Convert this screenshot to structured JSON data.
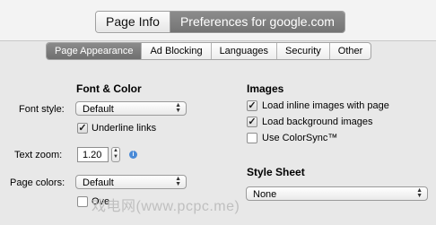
{
  "top_tabs": [
    "Page Info",
    "Preferences for google.com"
  ],
  "tabs": [
    "Page Appearance",
    "Ad Blocking",
    "Languages",
    "Security",
    "Other"
  ],
  "font_color": {
    "heading": "Font & Color",
    "font_style_label": "Font style:",
    "font_style_value": "Default",
    "underline_links": "Underline links",
    "text_zoom_label": "Text zoom:",
    "text_zoom_value": "1.20",
    "page_colors_label": "Page colors:",
    "page_colors_value": "Default",
    "override_label": "Ove"
  },
  "images": {
    "heading": "Images",
    "opt1": "Load inline images with page",
    "opt2": "Load background images",
    "opt3": "Use ColorSync™"
  },
  "style_sheet": {
    "heading": "Style Sheet",
    "value": "None"
  },
  "watermark": "戏电网(www.pcpc.me)"
}
